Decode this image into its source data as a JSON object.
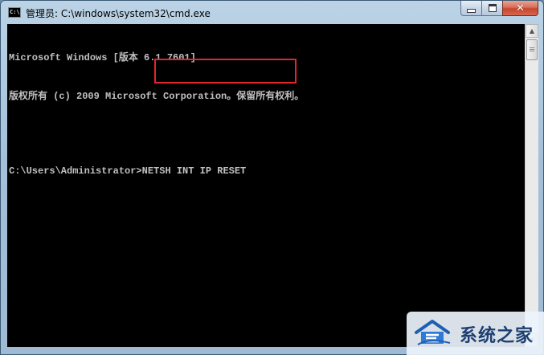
{
  "window": {
    "title": "管理员: C:\\windows\\system32\\cmd.exe",
    "app_icon_text": "C:\\"
  },
  "caption_buttons": {
    "minimize": "minimize-icon",
    "maximize": "maximize-icon",
    "close_glyph": "✕"
  },
  "console": {
    "lines": [
      "Microsoft Windows [版本 6.1.7601]",
      "版权所有 (c) 2009 Microsoft Corporation。保留所有权利。"
    ],
    "prompt": "C:\\Users\\Administrator>",
    "command": "NETSH INT IP RESET"
  },
  "scrollbar": {
    "up_glyph": "▲",
    "down_glyph": "▼"
  },
  "watermark": {
    "text": "系统之家",
    "logo_icon": "house-logo-icon"
  },
  "colors": {
    "highlight": "#e3262b",
    "console_bg": "#000000",
    "console_fg": "#c0c0c0",
    "watermark_text": "#1d3f72"
  }
}
